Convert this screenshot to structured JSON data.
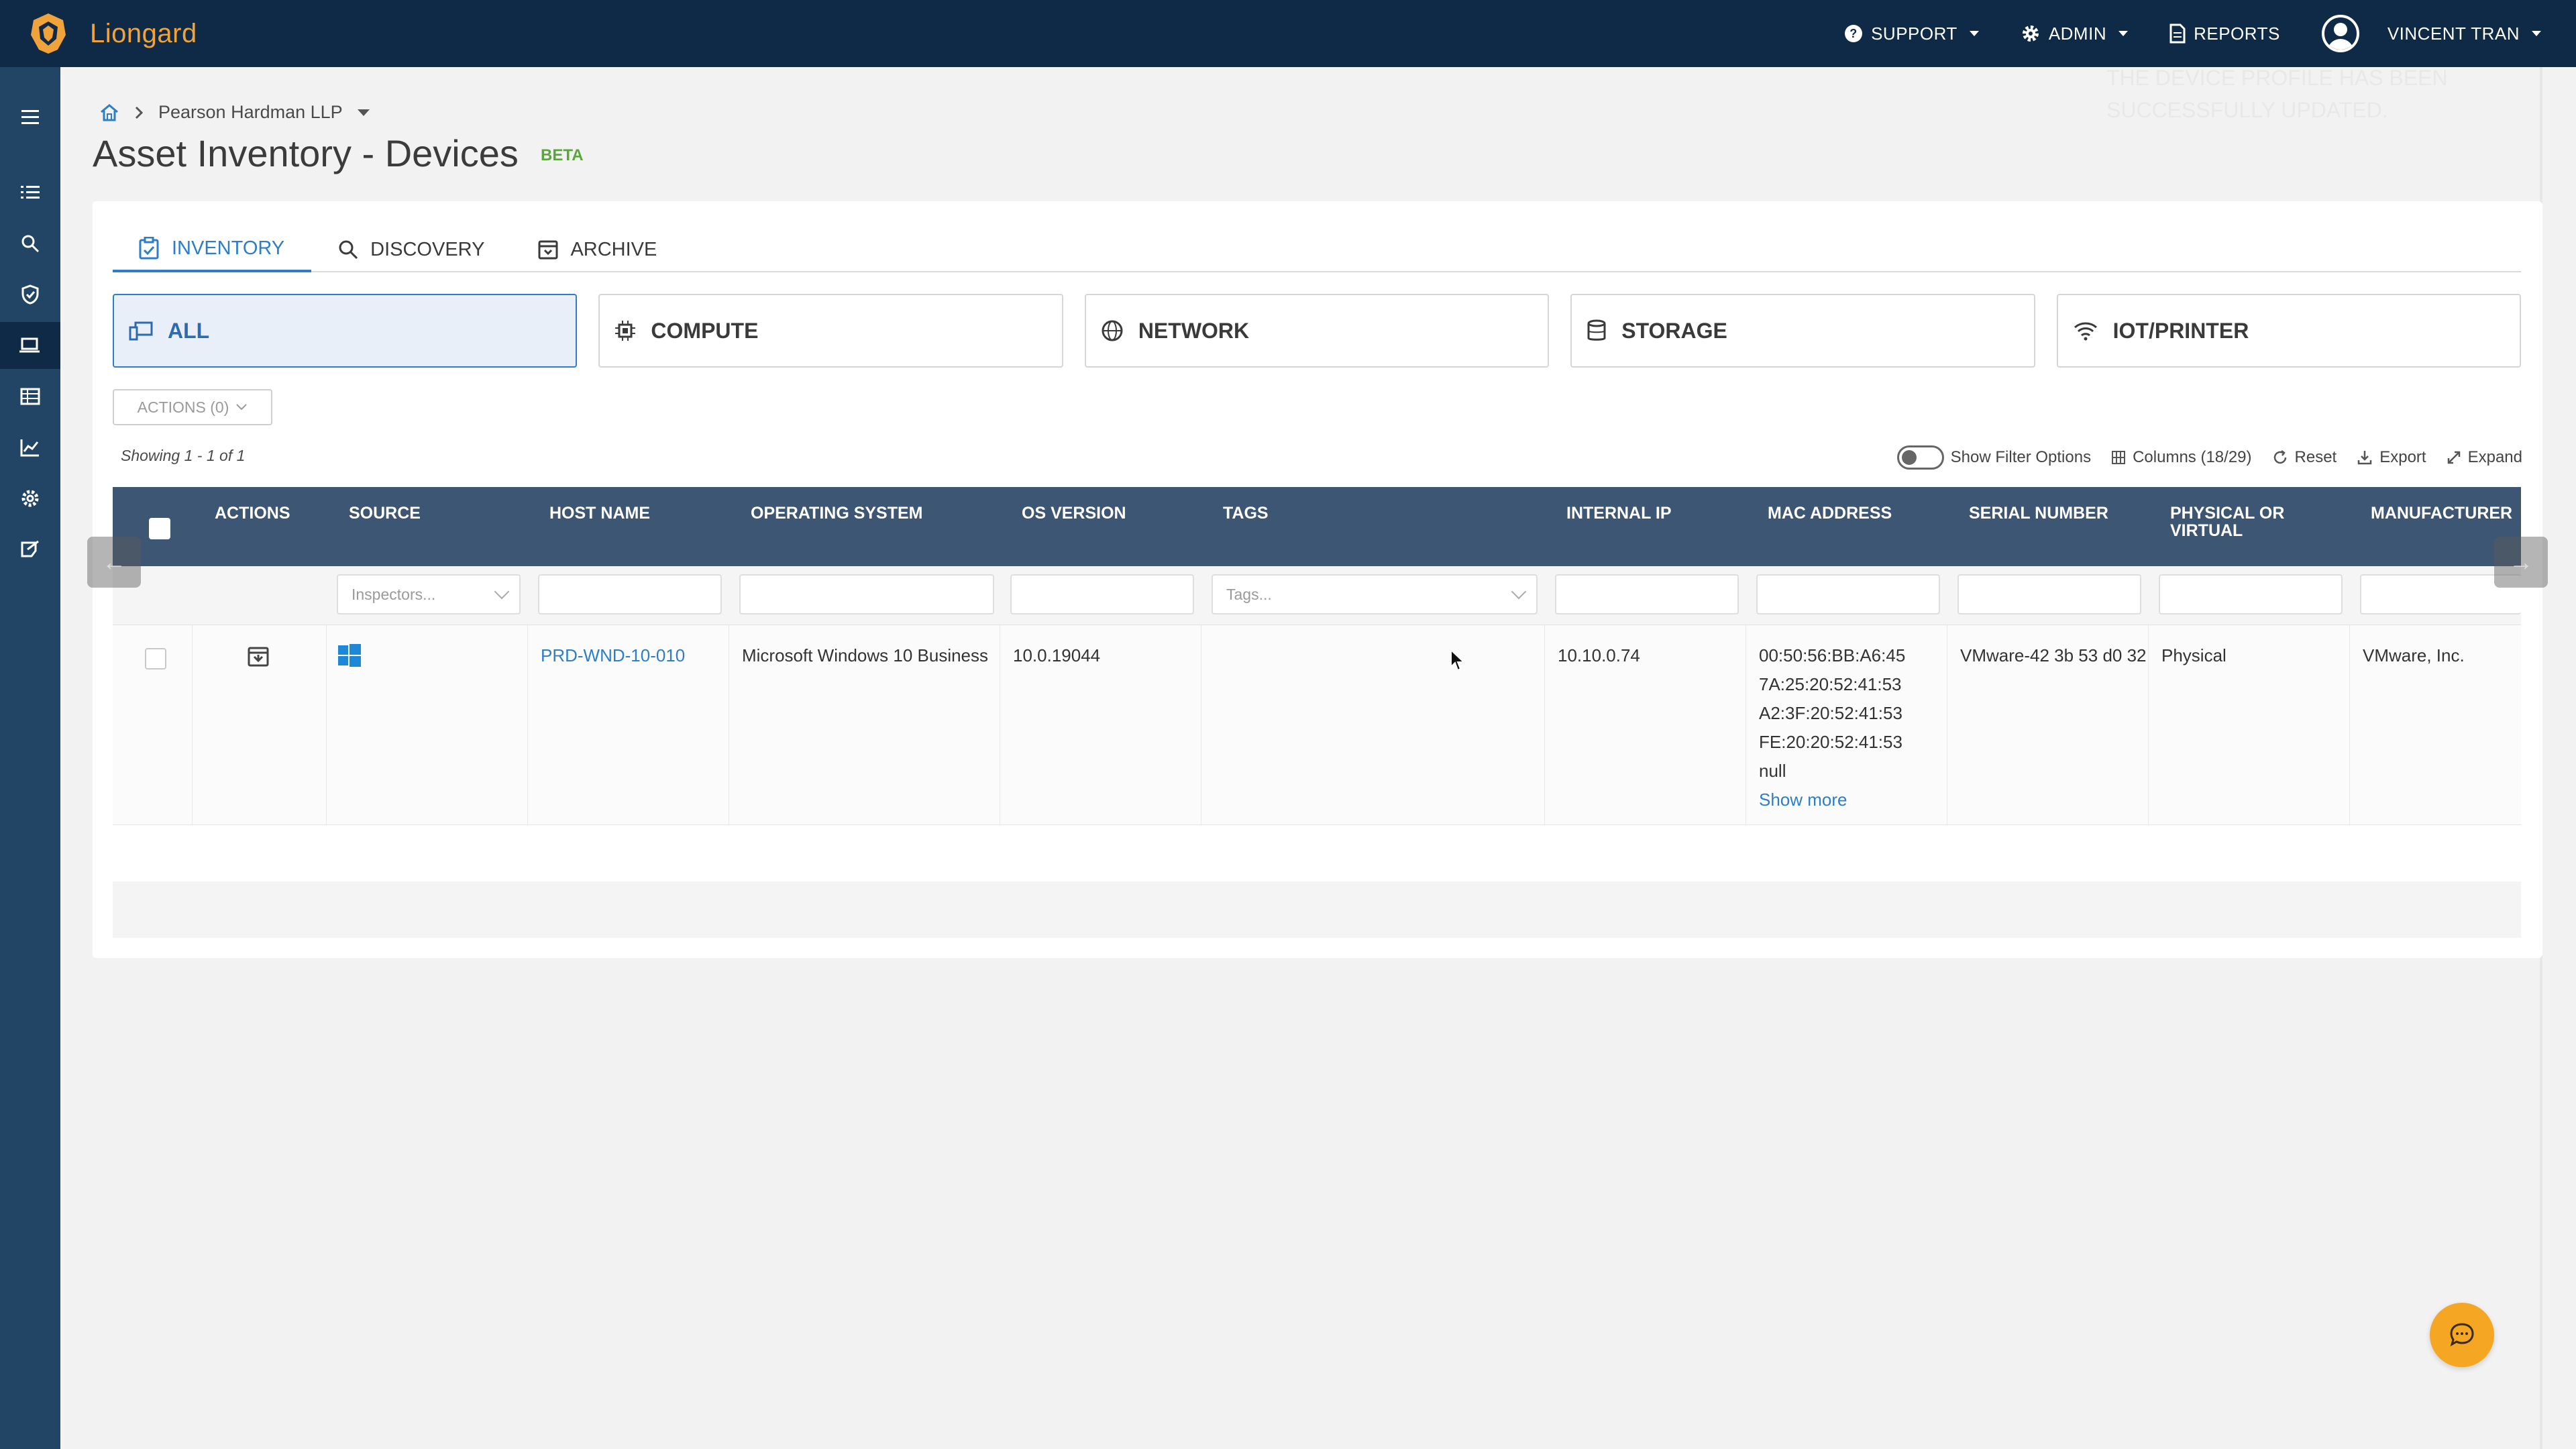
{
  "app": {
    "brand": "Liongard",
    "nav": {
      "support": "SUPPORT",
      "admin": "ADMIN",
      "reports": "REPORTS",
      "user": "VINCENT TRAN"
    }
  },
  "colors": {
    "topbar": "#0e2a47",
    "sidebar": "#234565",
    "accent": "#2d7ec6",
    "brand": "#f0a33a",
    "beta": "#5aa63a",
    "table_header": "#3d5673"
  },
  "breadcrumb": {
    "company": "Pearson Hardman LLP"
  },
  "page": {
    "title": "Asset Inventory - Devices",
    "badge": "BETA"
  },
  "toast": {
    "line1": "THE DEVICE PROFILE HAS BEEN",
    "line2": "SUCCESSFULLY UPDATED."
  },
  "tabs": [
    {
      "label": "INVENTORY",
      "icon": "inventory-icon"
    },
    {
      "label": "DISCOVERY",
      "icon": "search-icon"
    },
    {
      "label": "ARCHIVE",
      "icon": "archive-icon"
    }
  ],
  "categories": [
    {
      "label": "ALL",
      "icon": "devices-icon"
    },
    {
      "label": "COMPUTE",
      "icon": "chip-icon"
    },
    {
      "label": "NETWORK",
      "icon": "globe-icon"
    },
    {
      "label": "STORAGE",
      "icon": "database-icon"
    },
    {
      "label": "IOT/PRINTER",
      "icon": "wifi-icon"
    }
  ],
  "toolbar": {
    "actions": "ACTIONS (0)",
    "showing": "Showing 1 - 1 of 1",
    "show_filter": "Show Filter Options",
    "columns": "Columns (18/29)",
    "reset": "Reset",
    "export": "Export",
    "expand": "Expand"
  },
  "table": {
    "headers": {
      "actions": "ACTIONS",
      "source": "SOURCE",
      "host_name": "HOST NAME",
      "os": "OPERATING SYSTEM",
      "os_version": "OS VERSION",
      "tags": "TAGS",
      "internal_ip": "INTERNAL IP",
      "mac": "MAC ADDRESS",
      "serial": "SERIAL NUMBER",
      "physical_1": "PHYSICAL OR",
      "physical_2": "VIRTUAL",
      "manufacturer": "MANUFACTURER"
    },
    "filters": {
      "source_placeholder": "Inspectors...",
      "tags_placeholder": "Tags..."
    },
    "rows": [
      {
        "source_icon": "windows-icon",
        "host_name": "PRD-WND-10-010",
        "os": "Microsoft Windows 10 Business",
        "os_version": "10.0.19044",
        "tags": "",
        "internal_ip": "10.10.0.74",
        "mac": [
          "00:50:56:BB:A6:45",
          "7A:25:20:52:41:53",
          "A2:3F:20:52:41:53",
          "FE:20:20:52:41:53",
          "null"
        ],
        "show_more": "Show more",
        "serial": "VMware-42 3b 53 d0 32",
        "physical": "Physical",
        "manufacturer": "VMware, Inc."
      }
    ]
  }
}
